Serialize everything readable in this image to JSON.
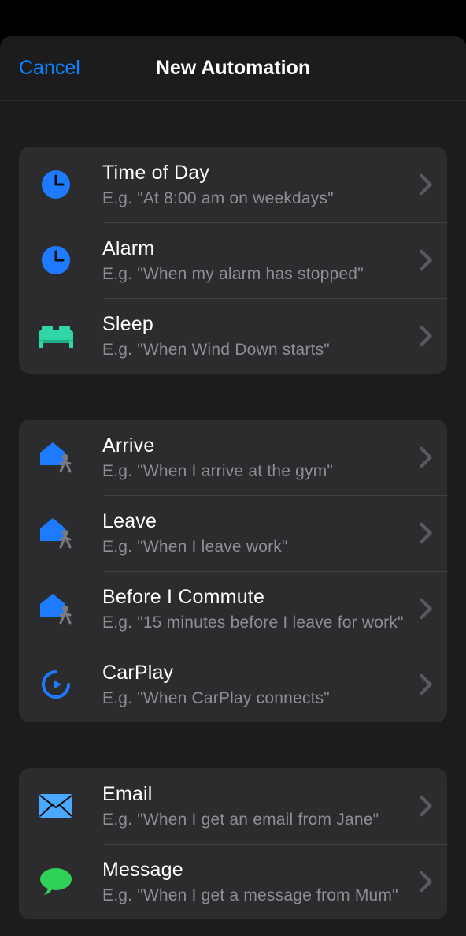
{
  "header": {
    "cancel": "Cancel",
    "title": "New Automation"
  },
  "groups": [
    {
      "rows": [
        {
          "icon": "clock-icon",
          "title": "Time of Day",
          "sub": "E.g. \"At 8:00 am on weekdays\""
        },
        {
          "icon": "clock-icon",
          "title": "Alarm",
          "sub": "E.g. \"When my alarm has stopped\""
        },
        {
          "icon": "bed-icon",
          "title": "Sleep",
          "sub": "E.g. \"When Wind Down starts\""
        }
      ]
    },
    {
      "rows": [
        {
          "icon": "home-person-icon",
          "title": "Arrive",
          "sub": "E.g. \"When I arrive at the gym\""
        },
        {
          "icon": "home-person-icon",
          "title": "Leave",
          "sub": "E.g. \"When I leave work\""
        },
        {
          "icon": "home-person-icon",
          "title": "Before I Commute",
          "sub": "E.g. \"15 minutes before I leave for work\""
        },
        {
          "icon": "carplay-icon",
          "title": "CarPlay",
          "sub": "E.g. \"When CarPlay connects\""
        }
      ]
    },
    {
      "rows": [
        {
          "icon": "email-icon",
          "title": "Email",
          "sub": "E.g. \"When I get an email from Jane\""
        },
        {
          "icon": "message-icon",
          "title": "Message",
          "sub": "E.g. \"When I get a message from Mum\""
        }
      ]
    }
  ],
  "colors": {
    "accent": "#0a84ff",
    "blue": "#1e7bff",
    "teal": "#30d6a6",
    "skyblue": "#4aa8ff",
    "green": "#30d158",
    "grey": "#8e8e93"
  }
}
